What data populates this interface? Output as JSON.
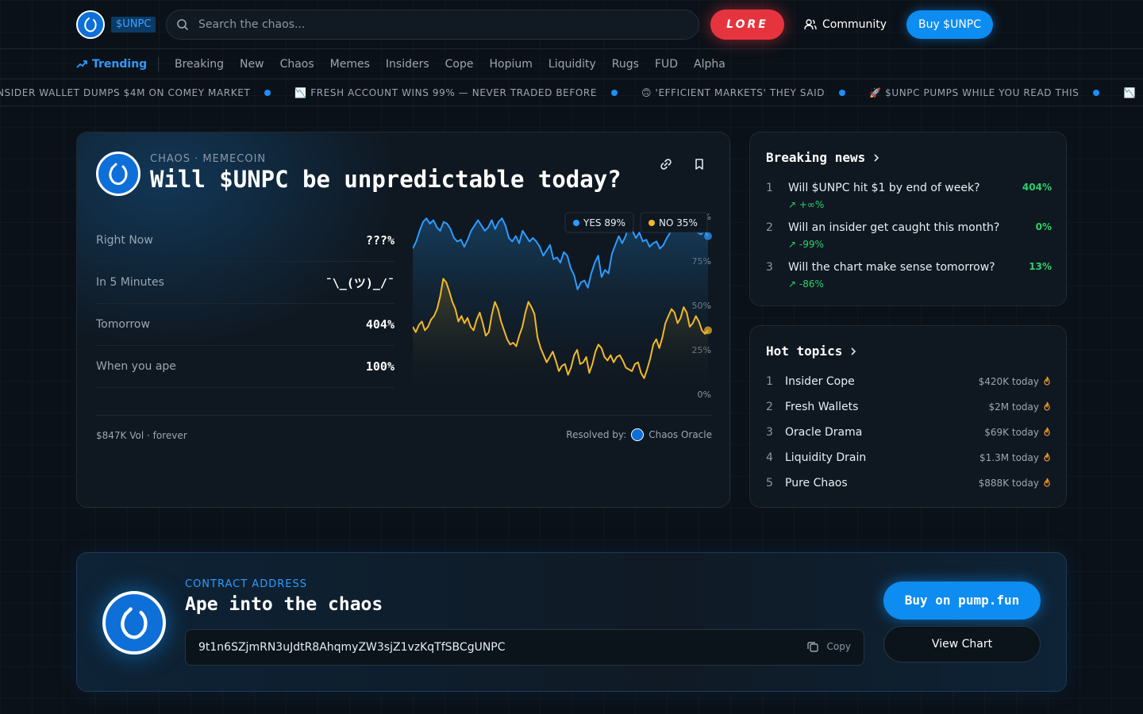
{
  "header": {
    "ticker_badge": "$UNPC",
    "search_placeholder": "Search the chaos...",
    "lore_label": "LORE",
    "community_label": "Community",
    "buy_label": "Buy $UNPC"
  },
  "nav": {
    "trending_label": "Trending",
    "items": [
      "Breaking",
      "New",
      "Chaos",
      "Memes",
      "Insiders",
      "Cope",
      "Hopium",
      "Liquidity",
      "Rugs",
      "FUD",
      "Alpha"
    ]
  },
  "ticker": [
    "NSIDER WALLET DUMPS $4M ON COMEY MARKET",
    "📉 FRESH ACCOUNT WINS 99% — NEVER TRADED BEFORE",
    "🙃 'EFFICIENT MARKETS' THEY SAID",
    "🚀 $UNPC PUMPS WHILE YOU READ THIS",
    "📉"
  ],
  "main_card": {
    "category": "CHAOS · MEMECOIN",
    "title": "Will $UNPC be unpredictable today?",
    "stats": [
      {
        "label": "Right Now",
        "value": "???%"
      },
      {
        "label": "In 5 Minutes",
        "value": "¯\\_(ツ)_/¯"
      },
      {
        "label": "Tomorrow",
        "value": "404%"
      },
      {
        "label": "When you ape",
        "value": "100%"
      }
    ],
    "volume": "$847K Vol · forever",
    "resolved_by_label": "Resolved by:",
    "resolver": "Chaos Oracle"
  },
  "chart_data": {
    "type": "line",
    "ylim": [
      0,
      100
    ],
    "y_ticks": [
      "100%",
      "75%",
      "50%",
      "25%",
      "0%"
    ],
    "legend": [
      {
        "label": "YES 89%",
        "color": "#2f9bff"
      },
      {
        "label": "NO 35%",
        "color": "#f2b82a"
      }
    ],
    "series": [
      {
        "name": "YES",
        "color": "#2f9bff",
        "values": [
          82,
          86,
          92,
          97,
          99,
          96,
          98,
          94,
          92,
          97,
          96,
          93,
          88,
          86,
          87,
          83,
          87,
          92,
          95,
          98,
          95,
          92,
          94,
          98,
          93,
          97,
          99,
          95,
          88,
          86,
          89,
          85,
          92,
          89,
          86,
          88,
          86,
          83,
          78,
          81,
          84,
          76,
          77,
          74,
          80,
          78,
          71,
          67,
          59,
          63,
          64,
          60,
          68,
          74,
          78,
          66,
          70,
          68,
          79,
          84,
          89,
          85,
          89,
          96,
          92,
          88,
          91,
          86,
          87,
          83,
          85,
          86,
          82,
          84,
          88,
          91,
          97,
          98,
          96,
          92,
          96,
          93,
          94,
          91,
          90,
          92,
          89
        ]
      },
      {
        "name": "NO",
        "color": "#f2b82a",
        "values": [
          38,
          35,
          39,
          41,
          36,
          38,
          42,
          44,
          48,
          55,
          65,
          63,
          58,
          52,
          48,
          41,
          44,
          40,
          43,
          38,
          36,
          42,
          46,
          40,
          33,
          35,
          45,
          52,
          48,
          41,
          36,
          31,
          28,
          29,
          27,
          33,
          38,
          46,
          52,
          49,
          45,
          32,
          26,
          22,
          18,
          21,
          24,
          19,
          13,
          16,
          17,
          11,
          15,
          22,
          25,
          17,
          18,
          21,
          12,
          17,
          24,
          28,
          26,
          21,
          19,
          22,
          18,
          21,
          22,
          19,
          15,
          14,
          13,
          17,
          18,
          12,
          9,
          14,
          20,
          28,
          31,
          26,
          32,
          40,
          44,
          48,
          46,
          40,
          43,
          49,
          46,
          38,
          40,
          44,
          41,
          36,
          34,
          36
        ]
      }
    ]
  },
  "breaking_news": {
    "title": "Breaking news",
    "items": [
      {
        "num": "1",
        "question": "Will $UNPC hit $1 by end of week?",
        "change": "↗ +∞%",
        "pct": "404%"
      },
      {
        "num": "2",
        "question": "Will an insider get caught this month?",
        "change": "↗ -99%",
        "pct": "0%"
      },
      {
        "num": "3",
        "question": "Will the chart make sense tomorrow?",
        "change": "↗ -86%",
        "pct": "13%"
      }
    ]
  },
  "hot_topics": {
    "title": "Hot topics",
    "items": [
      {
        "num": "1",
        "name": "Insider Cope",
        "amount": "$420K today"
      },
      {
        "num": "2",
        "name": "Fresh Wallets",
        "amount": "$2M today"
      },
      {
        "num": "3",
        "name": "Oracle Drama",
        "amount": "$69K today"
      },
      {
        "num": "4",
        "name": "Liquidity Drain",
        "amount": "$1.3M today"
      },
      {
        "num": "5",
        "name": "Pure Chaos",
        "amount": "$888K today"
      }
    ]
  },
  "contract": {
    "label": "CONTRACT ADDRESS",
    "title": "Ape into the chaos",
    "address": "9t1n6SZjmRN3uJdtR8AhqmyZW3sjZ1vzKqTfSBCgUNPC",
    "copy_label": "Copy",
    "buy_label": "Buy on pump.fun",
    "view_chart_label": "View Chart"
  }
}
